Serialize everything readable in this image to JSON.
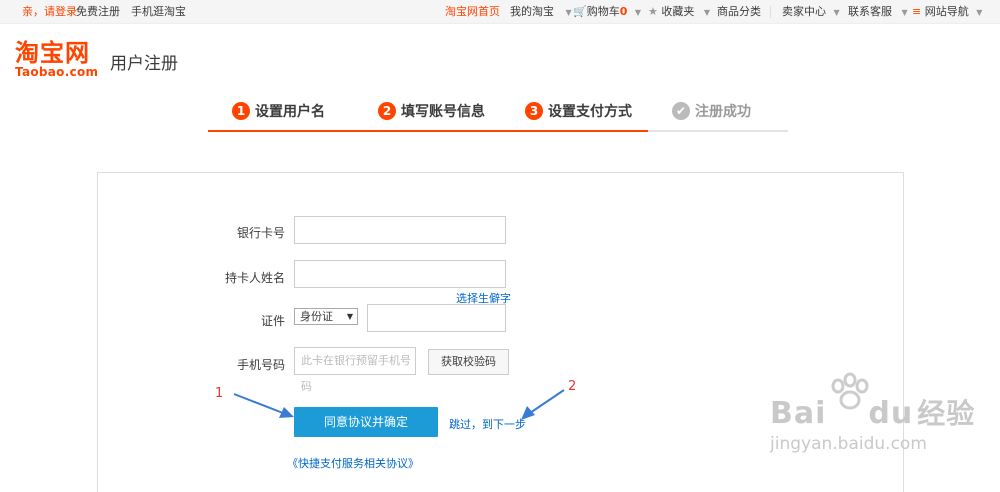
{
  "topbar": {
    "greeting": "亲，请登录",
    "register": "免费注册",
    "mobile": "手机逛淘宝",
    "home": "淘宝网首页",
    "my_taobao": "我的淘宝",
    "cart": "购物车",
    "cart_count": "0",
    "favorites": "收藏夹",
    "categories": "商品分类",
    "seller_center": "卖家中心",
    "support": "联系客服",
    "site_nav": "网站导航"
  },
  "header": {
    "logo_cn": "淘宝网",
    "logo_en": "Taobao.com",
    "title": "用户注册"
  },
  "steps": [
    {
      "num": "1",
      "label": "设置用户名"
    },
    {
      "num": "2",
      "label": "填写账号信息"
    },
    {
      "num": "3",
      "label": "设置支付方式"
    },
    {
      "num": "✔",
      "label": "注册成功"
    }
  ],
  "form": {
    "bank_card_label": "银行卡号",
    "holder_label": "持卡人姓名",
    "rare_char_link": "选择生僻字",
    "id_label": "证件",
    "id_type": "身份证",
    "phone_label": "手机号码",
    "phone_placeholder": "此卡在银行预留手机号码",
    "get_code": "获取校验码",
    "agree_button": "同意协议并确定",
    "skip_link": "跳过，到下一步",
    "agreement_link": "《快捷支付服务相关协议》"
  },
  "annotations": {
    "one": "1",
    "two": "2"
  },
  "watermark": {
    "brand": "Bai",
    "brand2": "du",
    "cn": "经验",
    "url": "jingyan.baidu.com"
  },
  "colors": {
    "accent": "#ff4400",
    "button": "#1d9bd6",
    "link": "#0066cc",
    "annotation_arrow": "#3a7bd5"
  }
}
